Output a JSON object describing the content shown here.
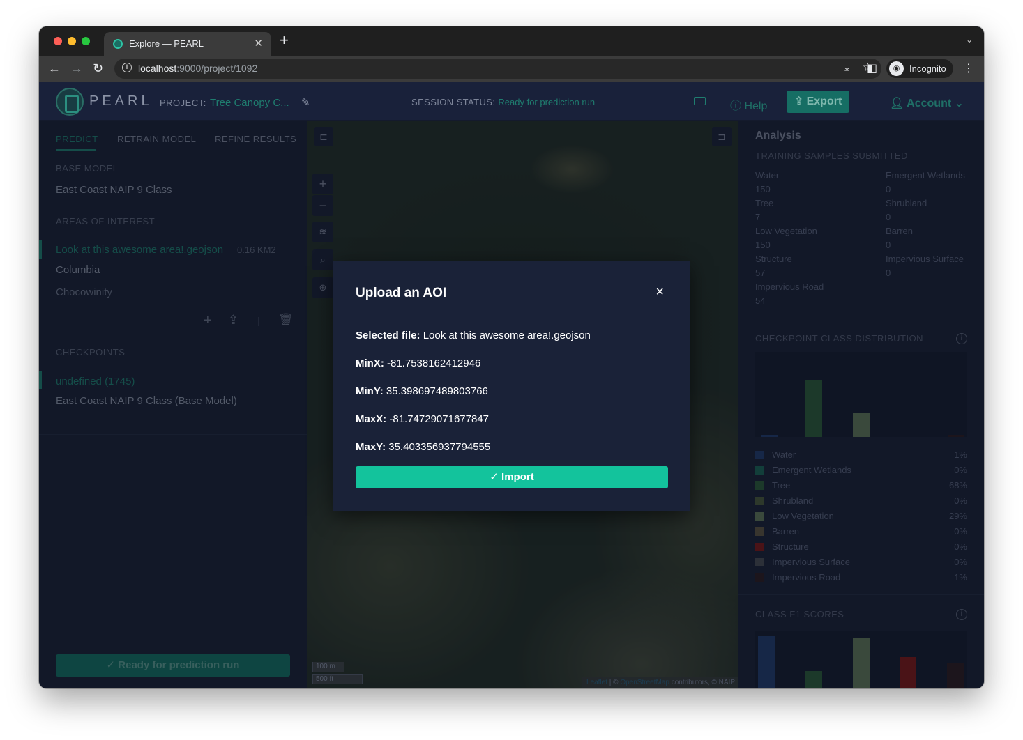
{
  "browser": {
    "tab_title": "Explore — PEARL",
    "url_host": "localhost",
    "url_rest": ":9000/project/1092",
    "incognito_label": "Incognito"
  },
  "header": {
    "logo": "PEARL",
    "project_label": "PROJECT:",
    "project_name": "Tree Canopy C...",
    "status_label": "SESSION STATUS:",
    "status_value": "Ready for prediction run",
    "help": "Help",
    "export": "Export",
    "account": "Account"
  },
  "left": {
    "tabs": [
      "PREDICT",
      "RETRAIN MODEL",
      "REFINE RESULTS"
    ],
    "base_model_label": "BASE MODEL",
    "base_model": "East Coast NAIP 9 Class",
    "aoi_label": "AREAS OF INTEREST",
    "aois": [
      {
        "name": "Look at this awesome area!.geojson",
        "size": "0.16 KM2"
      },
      {
        "name": "Columbia"
      },
      {
        "name": "Chocowinity"
      }
    ],
    "checkpoints_label": "CHECKPOINTS",
    "checkpoints": [
      "undefined (1745)",
      "East Coast NAIP 9 Class (Base Model)"
    ],
    "ready_button": "Ready for prediction run"
  },
  "map": {
    "scale_m": "100 m",
    "scale_ft": "500 ft",
    "attr_leaflet": "Leaflet",
    "attr_sep": " | © ",
    "attr_osm": "OpenStreetMap",
    "attr_rest": " contributors, © NAIP"
  },
  "right": {
    "title": "Analysis",
    "training_label": "TRAINING SAMPLES SUBMITTED",
    "training_left": [
      {
        "name": "Water",
        "count": "150"
      },
      {
        "name": "Tree",
        "count": "7"
      },
      {
        "name": "Low Vegetation",
        "count": "150"
      },
      {
        "name": "Structure",
        "count": "57"
      },
      {
        "name": "Impervious Road",
        "count": "54"
      }
    ],
    "training_right": [
      {
        "name": "Emergent Wetlands",
        "count": "0"
      },
      {
        "name": "Shrubland",
        "count": "0"
      },
      {
        "name": "Barren",
        "count": "0"
      },
      {
        "name": "Impervious Surface",
        "count": "0"
      }
    ],
    "checkpoint_dist_label": "CHECKPOINT CLASS DISTRIBUTION",
    "legend": [
      {
        "name": "Water",
        "value": "1%",
        "color": "#213b6b"
      },
      {
        "name": "Emergent Wetlands",
        "value": "0%",
        "color": "#1b6355"
      },
      {
        "name": "Tree",
        "value": "68%",
        "color": "#2c5a3a"
      },
      {
        "name": "Shrubland",
        "value": "0%",
        "color": "#49593b"
      },
      {
        "name": "Low Vegetation",
        "value": "29%",
        "color": "#5f7558"
      },
      {
        "name": "Barren",
        "value": "0%",
        "color": "#5c5440"
      },
      {
        "name": "Structure",
        "value": "0%",
        "color": "#7a1919"
      },
      {
        "name": "Impervious Surface",
        "value": "0%",
        "color": "#474a52"
      },
      {
        "name": "Impervious Road",
        "value": "1%",
        "color": "#2c1c22"
      }
    ],
    "f1_label": "CLASS F1 SCORES"
  },
  "modal": {
    "title": "Upload an AOI",
    "close": "×",
    "rows": [
      {
        "label": "Selected file:",
        "value": "Look at this awesome area!.geojson"
      },
      {
        "label": "MinX:",
        "value": "-81.7538162412946"
      },
      {
        "label": "MinY:",
        "value": "35.398697489803766"
      },
      {
        "label": "MaxX:",
        "value": "-81.74729071677847"
      },
      {
        "label": "MaxY:",
        "value": "35.403356937794555"
      }
    ],
    "import_label": "Import"
  }
}
